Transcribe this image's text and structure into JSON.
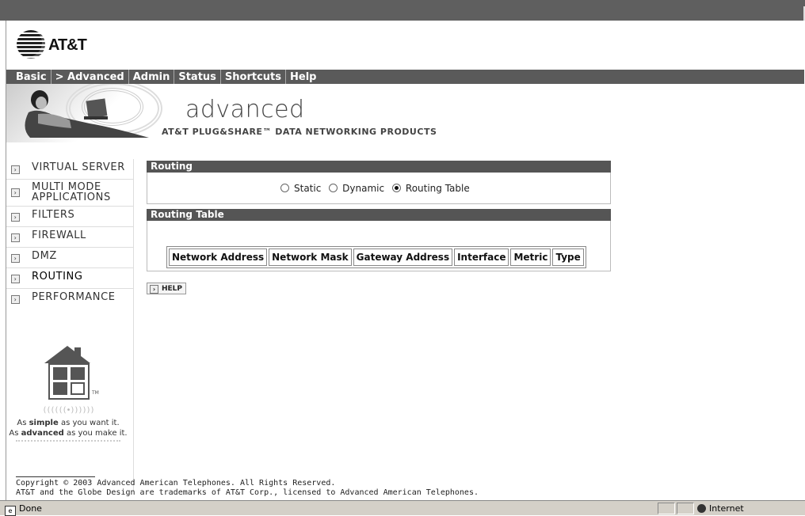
{
  "header": {
    "brand": "AT&T",
    "nav": [
      "Basic",
      "> Advanced",
      "Admin",
      "Status",
      "Shortcuts",
      "Help"
    ],
    "hero_word": "advanced",
    "hero_sub": "AT&T PLUG&SHARE™ DATA NETWORKING PRODUCTS"
  },
  "sidebar": {
    "items": [
      {
        "line1": "VIRTUAL SERVER",
        "line2": ""
      },
      {
        "line1": "MULTI MODE",
        "line2": "APPLICATIONS"
      },
      {
        "line1": "FILTERS",
        "line2": ""
      },
      {
        "line1": "FIREWALL",
        "line2": ""
      },
      {
        "line1": "DMZ",
        "line2": ""
      },
      {
        "line1": "ROUTING",
        "line2": ""
      },
      {
        "line1": "PERFORMANCE",
        "line2": ""
      }
    ],
    "active_item": "ROUTING",
    "tm": "TM",
    "tagline_dots": "((((((•))))))",
    "tagline_1": {
      "pre": "As ",
      "bold": "simple",
      "post": " as you want it."
    },
    "tagline_2": {
      "pre": "As ",
      "bold": "advanced",
      "post": " as you make it."
    }
  },
  "routing_panel": {
    "title": "Routing",
    "options": [
      "Static",
      "Dynamic",
      "Routing Table"
    ],
    "selected": "Routing Table"
  },
  "routing_table": {
    "title": "Routing Table",
    "columns": [
      "Network Address",
      "Network Mask",
      "Gateway Address",
      "Interface",
      "Metric",
      "Type"
    ],
    "rows": []
  },
  "help_button": "HELP",
  "footer": {
    "line1": "Copyright © 2003 Advanced American Telephones. All Rights Reserved.",
    "line2": "AT&T and the Globe Design are trademarks of AT&T Corp., licensed to Advanced American Telephones."
  },
  "status_bar": {
    "status": "Done",
    "zone": "Internet"
  }
}
